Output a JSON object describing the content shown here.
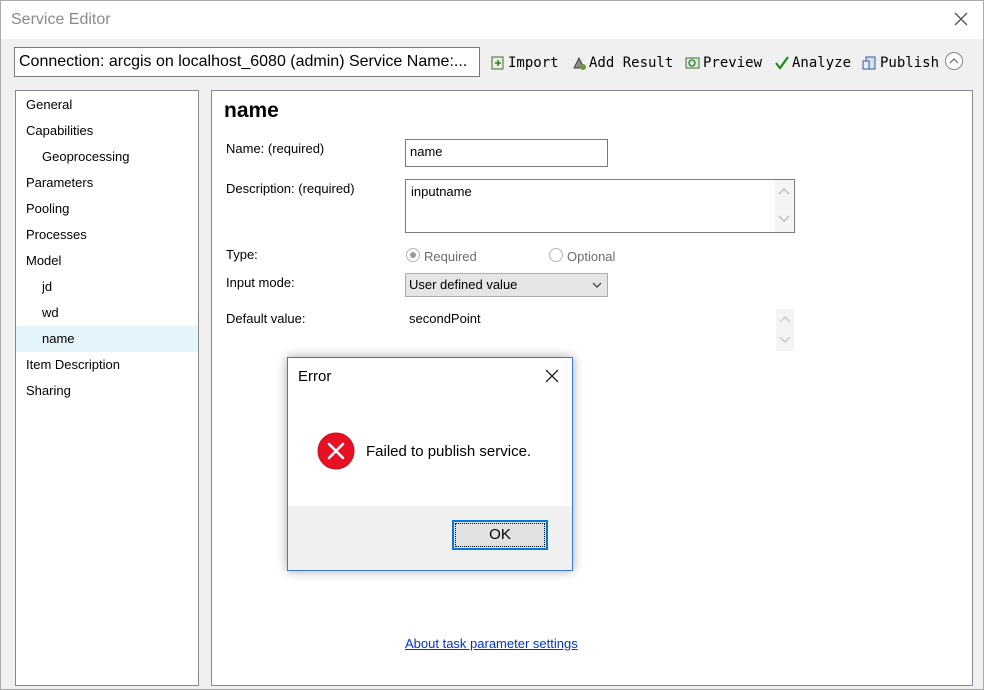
{
  "window": {
    "title": "Service Editor"
  },
  "toolbar": {
    "connection": "Connection: arcgis on localhost_6080 (admin)   Service Name:...",
    "import_label": "Import",
    "add_result_label": "Add Result",
    "preview_label": "Preview",
    "analyze_label": "Analyze",
    "publish_label": "Publish"
  },
  "sidebar": {
    "items": [
      {
        "label": "General"
      },
      {
        "label": "Capabilities"
      },
      {
        "label": "Geoprocessing"
      },
      {
        "label": "Parameters"
      },
      {
        "label": "Pooling"
      },
      {
        "label": "Processes"
      },
      {
        "label": "Model"
      },
      {
        "label": "jd"
      },
      {
        "label": "wd"
      },
      {
        "label": "name",
        "selected": true
      },
      {
        "label": "Item Description"
      },
      {
        "label": "Sharing"
      }
    ]
  },
  "main": {
    "heading": "name",
    "name_label": "Name:  (required)",
    "name_value": "name",
    "description_label": "Description:  (required)",
    "description_value": "inputname",
    "type_label": "Type:",
    "type_required": "Required",
    "type_optional": "Optional",
    "type_selected": "Required",
    "input_mode_label": "Input mode:",
    "input_mode_value": "User defined value",
    "default_label": "Default value:",
    "default_value": "secondPoint",
    "link": "About task parameter settings"
  },
  "dialog": {
    "title": "Error",
    "message": "Failed to publish service.",
    "ok_label": "OK",
    "icon": "error-icon"
  },
  "colors": {
    "accent": "#0078d7",
    "error": "#e81123",
    "selection": "#e5f3fb",
    "link": "#0033cc"
  }
}
